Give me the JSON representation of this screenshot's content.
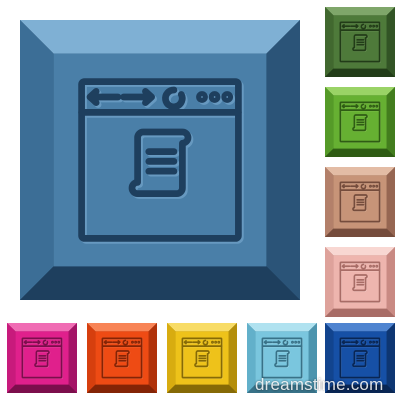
{
  "icon": "browser-script-icon",
  "watermark": "dreamstime.com",
  "tiles": {
    "main": {
      "icon": "browser-script-icon",
      "face": "#4a7fa8",
      "light": "#7fb0d4",
      "mid": "#3c6e96",
      "dark": "#2b5478",
      "deep": "#1e3f5e"
    },
    "green": {
      "icon": "browser-script-icon",
      "face": "#4e7a3a",
      "light": "#7fa66a",
      "mid": "#41682f",
      "dark": "#325425",
      "deep": "#223c18"
    },
    "lime": {
      "icon": "browser-script-icon",
      "face": "#66b032",
      "light": "#9ad366",
      "mid": "#559a28",
      "dark": "#437d1e",
      "deep": "#2f5c14"
    },
    "tan": {
      "icon": "browser-script-icon",
      "face": "#c79478",
      "light": "#e3bca5",
      "mid": "#b3806a",
      "dark": "#966652",
      "deep": "#754c3c"
    },
    "pink": {
      "icon": "browser-script-icon",
      "face": "#eeb5ae",
      "light": "#f8d7d2",
      "mid": "#dea29b",
      "dark": "#c98a83",
      "deep": "#a86c66"
    },
    "magenta": {
      "icon": "browser-script-icon",
      "face": "#e0208c",
      "light": "#f06cb4",
      "mid": "#c81a7c",
      "dark": "#a41466",
      "deep": "#7c0e4c"
    },
    "orange": {
      "icon": "browser-script-icon",
      "face": "#ee4b14",
      "light": "#f88456",
      "mid": "#d63f0e",
      "dark": "#b0320a",
      "deep": "#842406"
    },
    "yellow": {
      "icon": "browser-script-icon",
      "face": "#eec21a",
      "light": "#f8dc66",
      "mid": "#d8ac10",
      "dark": "#b48e0a",
      "deep": "#866a06"
    },
    "cyan": {
      "icon": "browser-script-icon",
      "face": "#7ac6de",
      "light": "#b0e2f0",
      "mid": "#62b0ca",
      "dark": "#4c94ae",
      "deep": "#387288"
    },
    "navy": {
      "icon": "browser-script-icon",
      "face": "#1650a6",
      "light": "#4f84d0",
      "mid": "#12448e",
      "dark": "#0e3672",
      "deep": "#092654"
    }
  }
}
